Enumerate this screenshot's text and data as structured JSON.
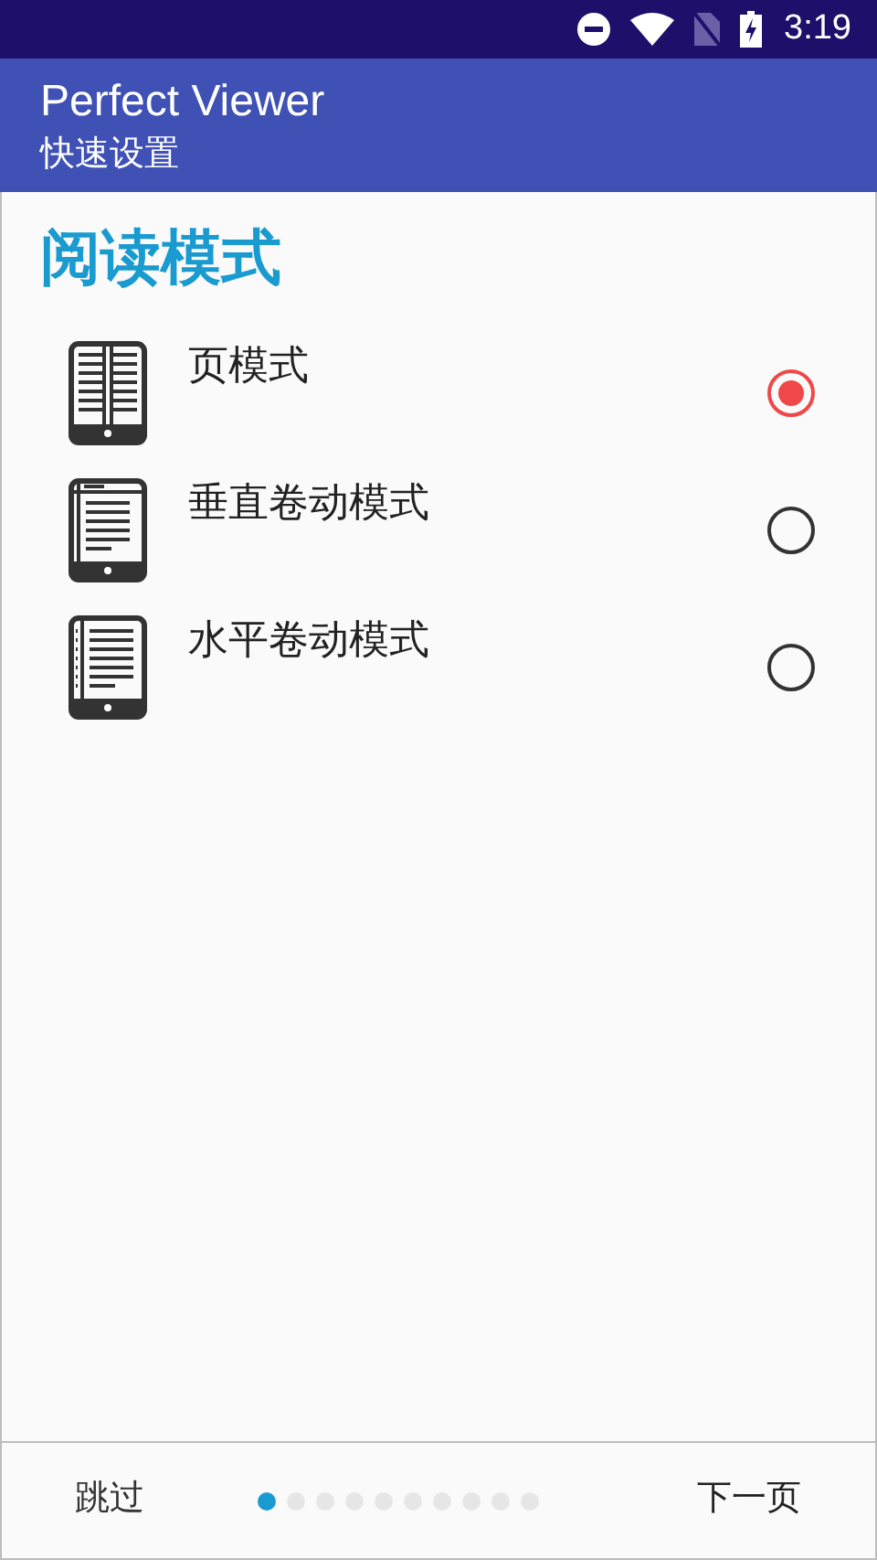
{
  "status_bar": {
    "time": "3:19"
  },
  "app_bar": {
    "title": "Perfect Viewer",
    "subtitle": "快速设置"
  },
  "section": {
    "title": "阅读模式"
  },
  "options": [
    {
      "kind": "page",
      "label": "页模式",
      "selected": true
    },
    {
      "kind": "vertical",
      "label": "垂直卷动模式",
      "selected": false
    },
    {
      "kind": "horizontal",
      "label": "水平卷动模式",
      "selected": false
    }
  ],
  "footer": {
    "skip": "跳过",
    "next": "下一页",
    "dots": [
      {
        "selected": true
      },
      {
        "selected": false
      },
      {
        "selected": false
      },
      {
        "selected": false
      },
      {
        "selected": false
      },
      {
        "selected": false
      },
      {
        "selected": false
      },
      {
        "selected": false
      },
      {
        "selected": false
      },
      {
        "selected": false
      }
    ]
  }
}
